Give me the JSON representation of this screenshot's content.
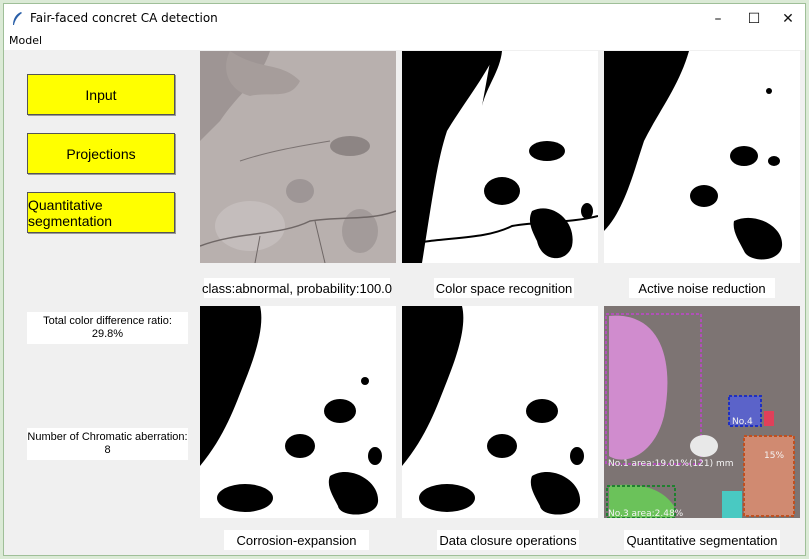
{
  "window": {
    "title": "Fair-faced concret CA detection",
    "controls": {
      "minimize": "–",
      "maximize": "☐",
      "close": "✕"
    }
  },
  "menu": {
    "model": "Model"
  },
  "buttons": {
    "input": "Input",
    "projections": "Projections",
    "segmentation": "Quantitative segmentation"
  },
  "stats": {
    "ratio_label": "Total color difference ratio:",
    "ratio_value": "29.8%",
    "count_label": "Number of Chromatic aberration:",
    "count_value": "8"
  },
  "captions": {
    "original": "class:abnormal, probability:100.0",
    "color_space": "Color space recognition",
    "noise_reduction": "Active noise reduction",
    "corrosion": "Corrosion-expansion",
    "closure": "Data closure operations",
    "quantitative": "Quantitative segmentation"
  },
  "overlay_labels": {
    "no4": "No.4",
    "no1": "No.1 area:19.01%(121) mm",
    "no3": "No.3 area:2.48%",
    "pct15": "15%"
  },
  "colors": {
    "yellow_button": "#ffff00",
    "concrete": "#b7acab",
    "blob": "#000000"
  }
}
